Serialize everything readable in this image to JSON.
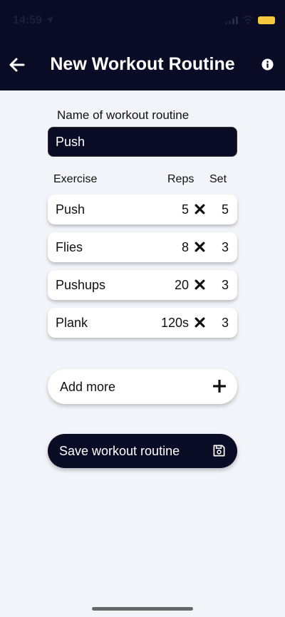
{
  "status": {
    "time": "14:59"
  },
  "header": {
    "title": "New Workout Routine"
  },
  "form": {
    "name_label": "Name of workout routine",
    "name_value": "Push"
  },
  "columns": {
    "exercise": "Exercise",
    "reps": "Reps",
    "set": "Set"
  },
  "exercises": [
    {
      "name": "Push",
      "reps": "5",
      "sets": "5"
    },
    {
      "name": "Flies",
      "reps": "8",
      "sets": "3"
    },
    {
      "name": "Pushups",
      "reps": "20",
      "sets": "3"
    },
    {
      "name": "Plank",
      "reps": "120s",
      "sets": "3"
    }
  ],
  "actions": {
    "add_more": "Add more",
    "save": "Save workout routine"
  },
  "colors": {
    "header_bg": "#0a0c26",
    "page_bg": "#f2f4f9",
    "battery": "#f4c93d"
  },
  "icons": {
    "back": "arrow-left-icon",
    "info": "info-icon",
    "times": "x-icon",
    "add": "plus-icon",
    "save": "floppy-disk-icon"
  }
}
